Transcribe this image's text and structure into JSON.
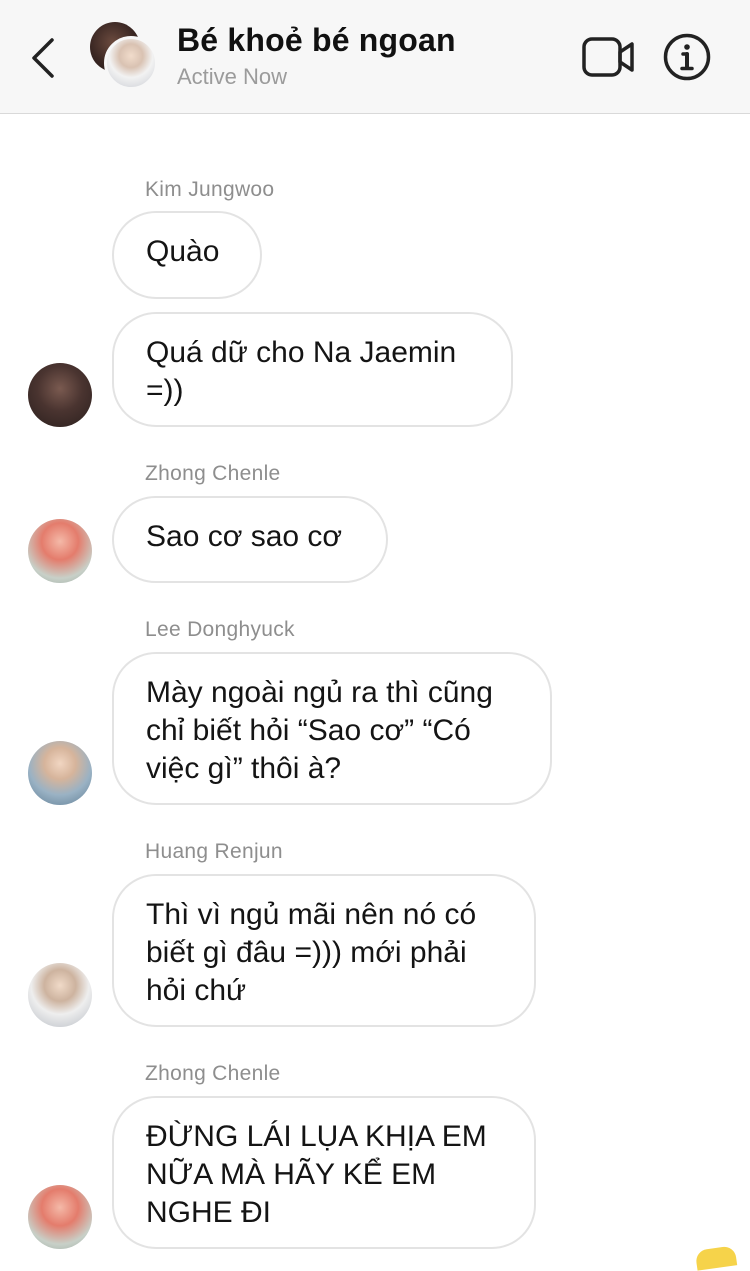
{
  "header": {
    "title": "Bé khoẻ bé ngoan",
    "status": "Active Now",
    "back_icon": "chevron-left-icon",
    "video_icon": "video-call-icon",
    "info_icon": "info-icon"
  },
  "messages": [
    {
      "sender": "Kim Jungwoo",
      "texts": [
        "Quào",
        "Quá dữ cho Na Jaemin =))"
      ]
    },
    {
      "sender": "Zhong Chenle",
      "texts": [
        "Sao cơ sao cơ"
      ]
    },
    {
      "sender": "Lee Donghyuck",
      "texts": [
        "Mày ngoài ngủ ra thì cũng chỉ biết hỏi “Sao cơ” “Có việc gì” thôi à?"
      ]
    },
    {
      "sender": "Huang Renjun",
      "texts": [
        "Thì vì ngủ mãi nên nó có biết gì đâu =))) mới phải hỏi chứ"
      ]
    },
    {
      "sender": "Zhong Chenle",
      "texts": [
        "ĐỪNG LÁI LỤA KHỊA EM NỮA MÀ HÃY KỂ EM NGHE ĐI"
      ]
    }
  ],
  "colors": {
    "header_bg": "#f7f7f7",
    "bubble_border": "#e3e3e3",
    "sender_text": "#8e8e8e",
    "status_text": "#9b9b9b"
  }
}
